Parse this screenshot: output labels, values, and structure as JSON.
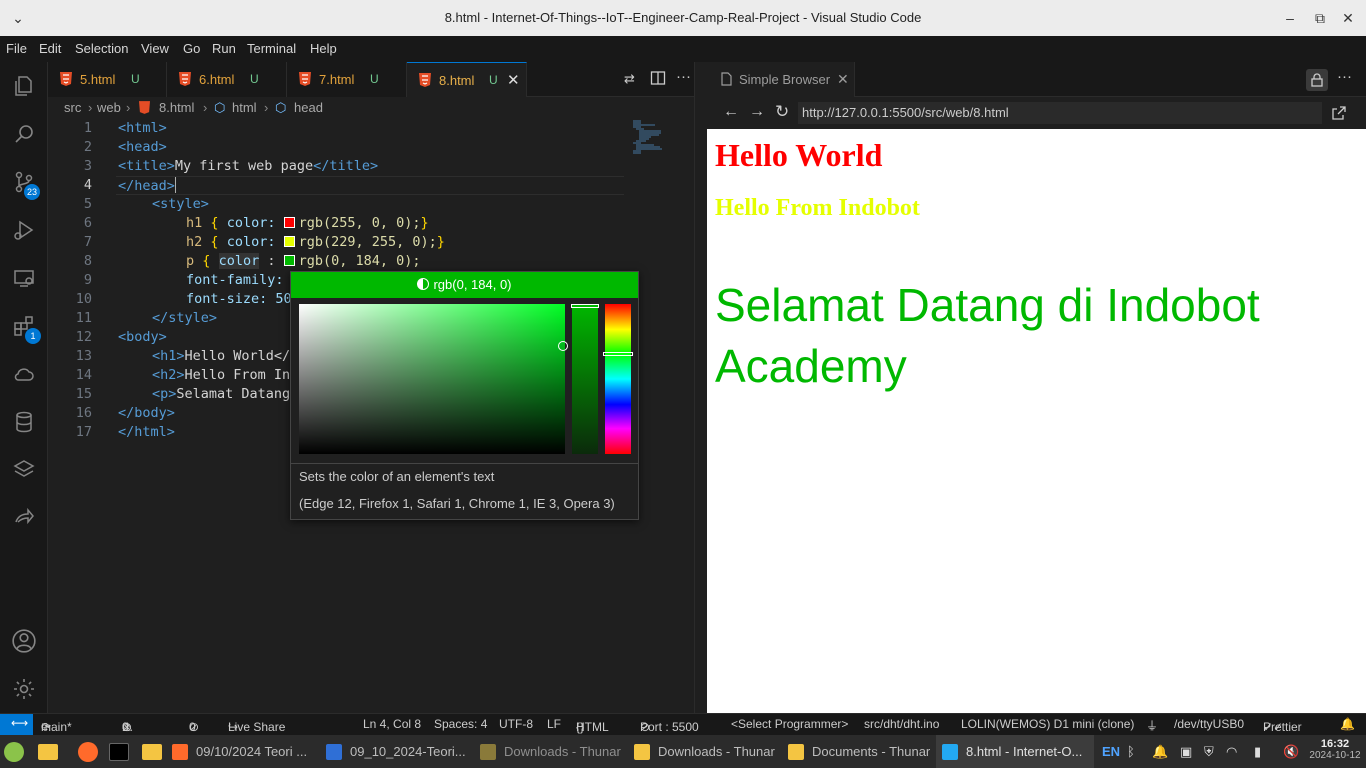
{
  "window": {
    "title": "8.html - Internet-Of-Things--IoT--Engineer-Camp-Real-Project - Visual Studio Code",
    "collapse_icon": "⌄"
  },
  "menu": [
    "File",
    "Edit",
    "Selection",
    "View",
    "Go",
    "Run",
    "Terminal",
    "Help"
  ],
  "activity": {
    "source_control_badge": "23",
    "extensions_badge": "1"
  },
  "tabs": [
    {
      "name": "5.html",
      "status": "U"
    },
    {
      "name": "6.html",
      "status": "U"
    },
    {
      "name": "7.html",
      "status": "U"
    },
    {
      "name": "8.html",
      "status": "U",
      "active": true
    }
  ],
  "breadcrumb": {
    "a": "src",
    "b": "web",
    "c": "8.html",
    "d": "html",
    "e": "head"
  },
  "code": {
    "line_numbers": [
      "1",
      "2",
      "3",
      "4",
      "5",
      "6",
      "7",
      "8",
      "9",
      "10",
      "11",
      "12",
      "13",
      "14",
      "15",
      "16",
      "17"
    ],
    "l1": "<html>",
    "l2": "<head>",
    "l3_open": "<title>",
    "l3_text": "My first web page",
    "l3_close": "</title>",
    "l4": "</head>",
    "l5": "<style>",
    "l6_sel": "h1",
    "l6_prop": "color:",
    "l6_val": "rgb(255, 0, 0);",
    "l7_sel": "h2",
    "l7_prop": "color:",
    "l7_val": "rgb(229, 255, 0);",
    "l8_sel": "p",
    "l8_prop": "color",
    "l8_val": "rgb(0, 184, 0);",
    "l9": "font-family:",
    "l10": "font-size: 50",
    "l11": "</style>",
    "l12": "<body>",
    "l13_tag": "<h1>",
    "l13_text": "Hello World</",
    "l14_tag": "<h2>",
    "l14_text": "Hello From In",
    "l15_tag": "<p>",
    "l15_text": "Selamat Datang",
    "l16": "</body>",
    "l17": "</html>",
    "swatch_h1": "#ff0000",
    "swatch_h2": "#e5ff00",
    "swatch_p": "#00b800"
  },
  "picker": {
    "header": "rgb(0, 184, 0)",
    "hover_desc": "Sets the color of an element's text",
    "hover_compat": "(Edge 12, Firefox 1, Safari 1, Chrome 1, IE 3, Opera 3)"
  },
  "browser": {
    "tab_title": "Simple Browser",
    "url": "http://127.0.0.1:5500/src/web/8.html",
    "h1": "Hello World",
    "h2": "Hello From Indobot",
    "p": "Selamat Datang di Indobot Academy",
    "h1_color": "#ff0000",
    "h2_color": "#e5ff00",
    "p_color": "#00b800"
  },
  "status": {
    "branch": "main*",
    "errors": "0",
    "warnings": "0",
    "ports": "0",
    "live_share": "Live Share",
    "position": "Ln 4, Col 8",
    "spaces": "Spaces: 4",
    "encoding": "UTF-8",
    "eol": "LF",
    "language": "HTML",
    "port": "Port : 5500",
    "programmer": "<Select Programmer>",
    "sketch": "src/dht/dht.ino",
    "board": "LOLIN(WEMOS) D1 mini (clone)",
    "serial": "/dev/ttyUSB0",
    "prettier": "Prettier"
  },
  "taskbar": {
    "items": [
      "09/10/2024 Teori ...",
      "09_10_2024-Teori...",
      "Downloads - Thunar",
      "Downloads - Thunar",
      "Documents - Thunar",
      "8.html - Internet-O..."
    ],
    "lang": "EN",
    "time": "16:32",
    "date": "2024-10-12"
  }
}
